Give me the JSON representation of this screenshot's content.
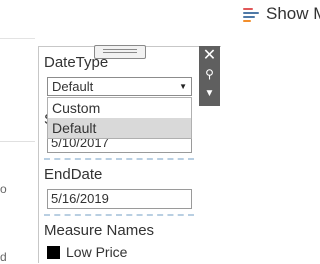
{
  "toolbar": {
    "show_me_label": "Show M",
    "show_me_icon": "show-me-bars-icon"
  },
  "left_fragments": {
    "item1": "o",
    "item2": "d"
  },
  "parameter_control": {
    "datetype": {
      "title": "DateType",
      "selected_value": "Default",
      "options": [
        "Custom",
        "Default"
      ],
      "highlighted_option": "Default"
    },
    "startdate": {
      "title_visible": "S",
      "value": "5/10/2017"
    },
    "enddate": {
      "title": "EndDate",
      "value": "5/16/2019"
    },
    "controls": {
      "close_icon": "close-icon",
      "pin_icon": "pin-icon",
      "menu_icon": "menu-arrow-icon"
    }
  },
  "legend": {
    "title": "Measure Names",
    "items": [
      {
        "label": "Low Price",
        "color": "#000000"
      }
    ]
  },
  "colors": {
    "show_me_bars": [
      "#e15759",
      "#4e79a7",
      "#4e79a7",
      "#f28e2b"
    ],
    "control_bar": "#5f5f5f",
    "dash": "#b9cfe2",
    "selected_row": "#d9d9d9"
  }
}
